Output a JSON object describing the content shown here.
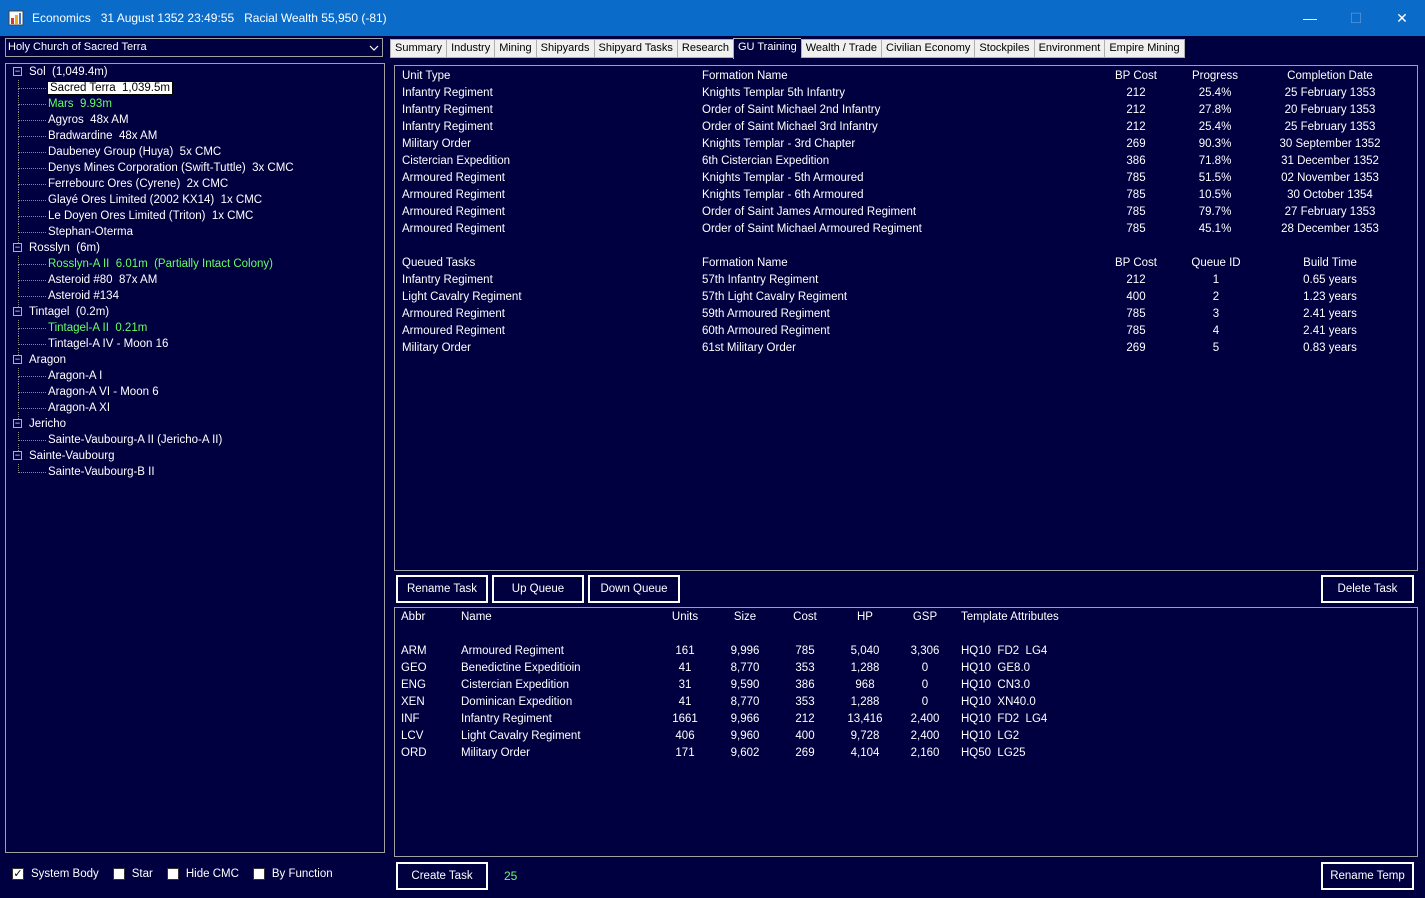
{
  "window": {
    "title": "Economics   31 August 1352 23:49:55   Racial Wealth 55,950 (-81)",
    "minimize": "—",
    "maximize": "☐",
    "close": "✕"
  },
  "empire_select": {
    "value": "Holy Church of Sacred Terra"
  },
  "tree": [
    {
      "text": "Sol  (1,049.4m)",
      "level": 0,
      "toggle": "−"
    },
    {
      "text": "Sacred Terra  1,039.5m",
      "level": 1,
      "style": "selected"
    },
    {
      "text": "Mars  9.93m",
      "level": 1,
      "style": "green"
    },
    {
      "text": "Agyros  48x AM",
      "level": 1
    },
    {
      "text": "Bradwardine  48x AM",
      "level": 1
    },
    {
      "text": "Daubeney Group (Huya)  5x CMC",
      "level": 1
    },
    {
      "text": "Denys Mines Corporation (Swift-Tuttle)  3x CMC",
      "level": 1
    },
    {
      "text": "Ferrebourc Ores (Cyrene)  2x CMC",
      "level": 1
    },
    {
      "text": "Glayé Ores Limited (2002 KX14)  1x CMC",
      "level": 1
    },
    {
      "text": "Le Doyen Ores Limited (Triton)  1x CMC",
      "level": 1
    },
    {
      "text": "Stephan-Oterma",
      "level": 1
    },
    {
      "text": "Rosslyn  (6m)",
      "level": 0,
      "toggle": "−"
    },
    {
      "text": "Rosslyn-A II  6.01m  (Partially Intact Colony)",
      "level": 1,
      "style": "green"
    },
    {
      "text": "Asteroid #80  87x AM",
      "level": 1
    },
    {
      "text": "Asteroid #134",
      "level": 1
    },
    {
      "text": "Tintagel  (0.2m)",
      "level": 0,
      "toggle": "−"
    },
    {
      "text": "Tintagel-A II  0.21m",
      "level": 1,
      "style": "green"
    },
    {
      "text": "Tintagel-A IV - Moon 16",
      "level": 1
    },
    {
      "text": "Aragon",
      "level": 0,
      "toggle": "−"
    },
    {
      "text": "Aragon-A I",
      "level": 1
    },
    {
      "text": "Aragon-A VI - Moon 6",
      "level": 1
    },
    {
      "text": "Aragon-A XI",
      "level": 1
    },
    {
      "text": "Jericho",
      "level": 0,
      "toggle": "−"
    },
    {
      "text": "Sainte-Vaubourg-A II (Jericho-A II)",
      "level": 1
    },
    {
      "text": "Sainte-Vaubourg",
      "level": 0,
      "toggle": "−"
    },
    {
      "text": "Sainte-Vaubourg-B II",
      "level": 1
    }
  ],
  "checkboxes": [
    {
      "label": "System Body",
      "checked": true,
      "mark": "✓"
    },
    {
      "label": "Star",
      "checked": false,
      "mark": ""
    },
    {
      "label": "Hide CMC",
      "checked": false,
      "mark": ""
    },
    {
      "label": "By Function",
      "checked": false,
      "mark": ""
    }
  ],
  "tabs": [
    {
      "label": "Summary"
    },
    {
      "label": "Industry"
    },
    {
      "label": "Mining"
    },
    {
      "label": "Shipyards"
    },
    {
      "label": "Shipyard Tasks"
    },
    {
      "label": "Research"
    },
    {
      "label": "GU Training",
      "active": true
    },
    {
      "label": "Wealth / Trade"
    },
    {
      "label": "Civilian Economy"
    },
    {
      "label": "Stockpiles"
    },
    {
      "label": "Environment"
    },
    {
      "label": "Empire Mining"
    }
  ],
  "active_tasks": {
    "headers": [
      "Unit Type",
      "Formation Name",
      "BP Cost",
      "Progress",
      "Completion Date"
    ],
    "rows": [
      [
        "Infantry Regiment",
        "Knights Templar 5th Infantry",
        "212",
        "25.4%",
        "25 February 1353"
      ],
      [
        "Infantry Regiment",
        "Order of Saint Michael 2nd Infantry",
        "212",
        "27.8%",
        "20 February 1353"
      ],
      [
        "Infantry Regiment",
        "Order of Saint Michael 3rd Infantry",
        "212",
        "25.4%",
        "25 February 1353"
      ],
      [
        "Military Order",
        "Knights Templar - 3rd Chapter",
        "269",
        "90.3%",
        "30 September 1352"
      ],
      [
        "Cistercian Expedition",
        "6th Cistercian Expedition",
        "386",
        "71.8%",
        "31 December 1352"
      ],
      [
        "Armoured Regiment",
        "Knights Templar - 5th Armoured",
        "785",
        "51.5%",
        "02 November 1353"
      ],
      [
        "Armoured Regiment",
        "Knights Templar - 6th Armoured",
        "785",
        "10.5%",
        "30 October 1354"
      ],
      [
        "Armoured Regiment",
        "Order of Saint James Armoured Regiment",
        "785",
        "79.7%",
        "27 February 1353"
      ],
      [
        "Armoured Regiment",
        "Order of Saint Michael Armoured Regiment",
        "785",
        "45.1%",
        "28 December 1353"
      ]
    ]
  },
  "queued_tasks": {
    "headers": [
      "Queued Tasks",
      "Formation Name",
      "BP Cost",
      "Queue ID",
      "Build Time"
    ],
    "rows": [
      [
        "Infantry Regiment",
        "57th Infantry Regiment",
        "212",
        "1",
        "0.65 years"
      ],
      [
        "Light Cavalry Regiment",
        "57th Light Cavalry Regiment",
        "400",
        "2",
        "1.23 years"
      ],
      [
        "Armoured Regiment",
        "59th Armoured Regiment",
        "785",
        "3",
        "2.41 years"
      ],
      [
        "Armoured Regiment",
        "60th Armoured Regiment",
        "785",
        "4",
        "2.41 years"
      ],
      [
        "Military Order",
        "61st Military Order",
        "269",
        "5",
        "0.83 years"
      ]
    ]
  },
  "buttons": {
    "rename_task": "Rename Task",
    "up_queue": "Up Queue",
    "down_queue": "Down Queue",
    "delete_task": "Delete Task",
    "create_task": "Create Task",
    "rename_temp": "Rename Temp"
  },
  "templates": {
    "headers": [
      "Abbr",
      "Name",
      "Units",
      "Size",
      "Cost",
      "HP",
      "GSP",
      "Template Attributes"
    ],
    "rows": [
      [
        "ARM",
        "Armoured Regiment",
        "161",
        "9,996",
        "785",
        "5,040",
        "3,306",
        "HQ10  FD2  LG4"
      ],
      [
        "GEO",
        "Benedictine Expeditioin",
        "41",
        "8,770",
        "353",
        "1,288",
        "0",
        "HQ10  GE8.0"
      ],
      [
        "ENG",
        "Cistercian Expedition",
        "31",
        "9,590",
        "386",
        "968",
        "0",
        "HQ10  CN3.0"
      ],
      [
        "XEN",
        "Dominican Expedition",
        "41",
        "8,770",
        "353",
        "1,288",
        "0",
        "HQ10  XN40.0"
      ],
      [
        "INF",
        "Infantry Regiment",
        "1661",
        "9,966",
        "212",
        "13,416",
        "2,400",
        "HQ10  FD2  LG4"
      ],
      [
        "LCV",
        "Light Cavalry Regiment",
        "406",
        "9,960",
        "400",
        "9,728",
        "2,400",
        "HQ10  LG2"
      ],
      [
        "ORD",
        "Military Order",
        "171",
        "9,602",
        "269",
        "4,104",
        "2,160",
        "HQ50  LG25"
      ]
    ]
  },
  "task_count": "25",
  "colors": {
    "background": "#000040",
    "titlebar": "#0a6bc9",
    "highlight": "#66ff66"
  }
}
